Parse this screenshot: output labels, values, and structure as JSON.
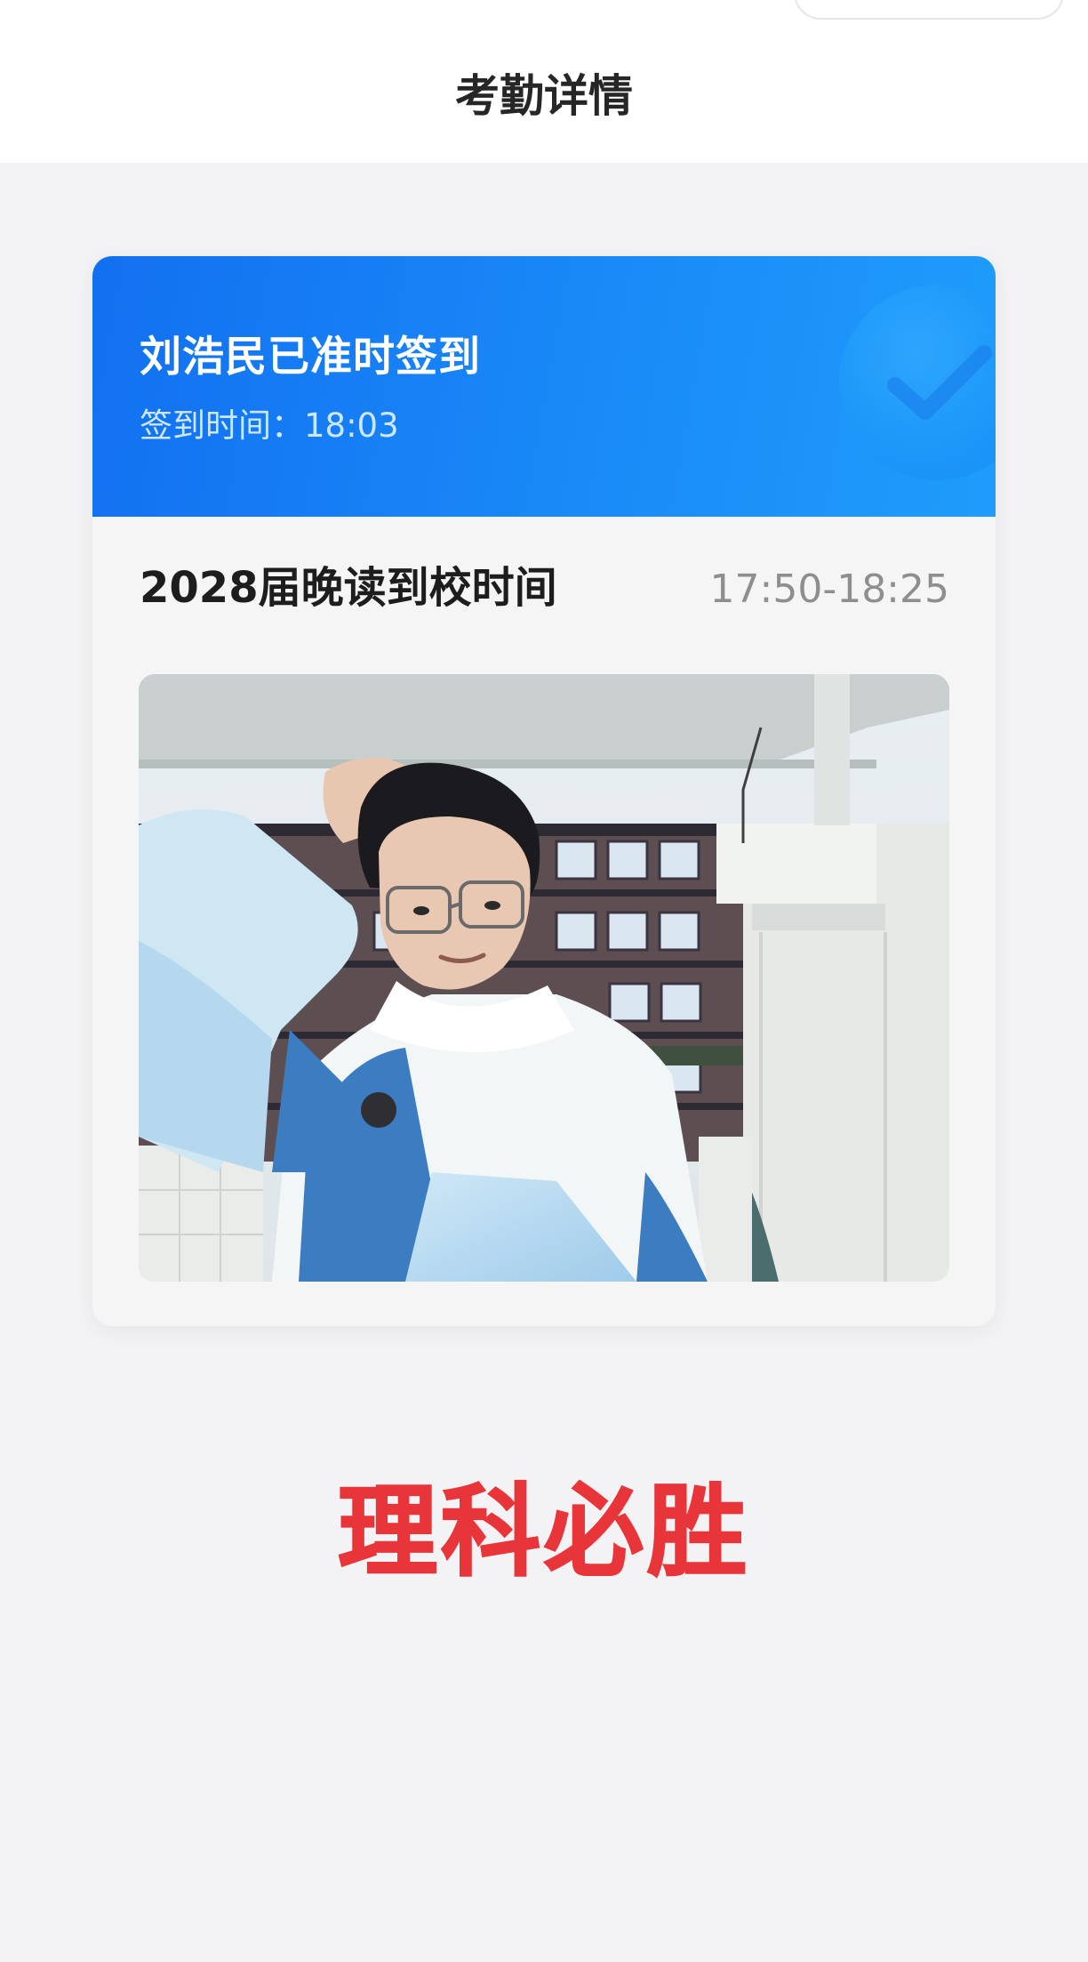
{
  "header": {
    "title": "考勤详情"
  },
  "status": {
    "title": "刘浩民已准时签到",
    "checkin_label": "签到时间：",
    "checkin_time": "18:03"
  },
  "session": {
    "title": "2028届晚读到校时间",
    "time_range": "17:50-18:25"
  },
  "photo": {
    "icon": "checkin-photo"
  },
  "motto": "理科必胜",
  "colors": {
    "banner": "#1270f0",
    "motto": "#e8353a",
    "background": "#f3f3f5"
  }
}
